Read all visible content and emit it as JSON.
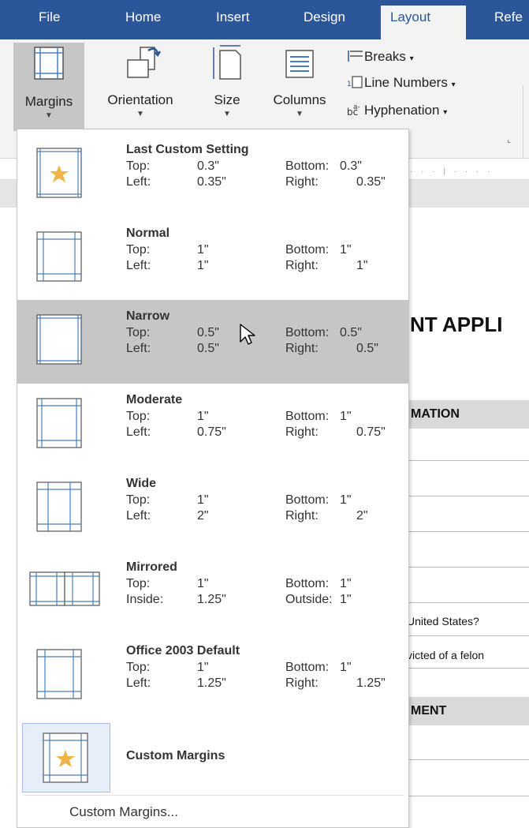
{
  "tabs": [
    {
      "label": "File",
      "active": false
    },
    {
      "label": "Home",
      "active": false
    },
    {
      "label": "Insert",
      "active": false
    },
    {
      "label": "Design",
      "active": false
    },
    {
      "label": "Layout",
      "active": true
    },
    {
      "label": "Refe",
      "active": false
    }
  ],
  "ribbon": {
    "margins": {
      "label": "Margins",
      "icon": "margins-icon"
    },
    "orientation": {
      "label": "Orientation",
      "icon": "orientation-icon"
    },
    "size": {
      "label": "Size",
      "icon": "size-icon"
    },
    "columns": {
      "label": "Columns",
      "icon": "columns-icon"
    },
    "breaks": {
      "label": "Breaks",
      "icon": "breaks-icon"
    },
    "line_numbers": {
      "label": "Line Numbers",
      "icon": "line-numbers-icon"
    },
    "hyphenation": {
      "label": "Hyphenation",
      "icon": "hyphenation-icon"
    }
  },
  "margins_menu": {
    "items": [
      {
        "name": "Last Custom Setting",
        "r1_l": "Top:",
        "r1_v": "0.3\"",
        "r1_rl": "Bottom:",
        "r1_rv": "0.3\"",
        "r2_l": "Left:",
        "r2_v": "0.35\"",
        "r2_rl": "Right:",
        "r2_rv": "0.35\"",
        "highlighted": false,
        "icon": "custom-page-star-icon"
      },
      {
        "name": "Normal",
        "r1_l": "Top:",
        "r1_v": "1\"",
        "r1_rl": "Bottom:",
        "r1_rv": "1\"",
        "r2_l": "Left:",
        "r2_v": "1\"",
        "r2_rl": "Right:",
        "r2_rv": "1\"",
        "highlighted": false,
        "icon": "page-margins-icon"
      },
      {
        "name": "Narrow",
        "r1_l": "Top:",
        "r1_v": "0.5\"",
        "r1_rl": "Bottom:",
        "r1_rv": "0.5\"",
        "r2_l": "Left:",
        "r2_v": "0.5\"",
        "r2_rl": "Right:",
        "r2_rv": "0.5\"",
        "highlighted": true,
        "icon": "page-margins-icon"
      },
      {
        "name": "Moderate",
        "r1_l": "Top:",
        "r1_v": "1\"",
        "r1_rl": "Bottom:",
        "r1_rv": "1\"",
        "r2_l": "Left:",
        "r2_v": "0.75\"",
        "r2_rl": "Right:",
        "r2_rv": "0.75\"",
        "highlighted": false,
        "icon": "page-margins-icon"
      },
      {
        "name": "Wide",
        "r1_l": "Top:",
        "r1_v": "1\"",
        "r1_rl": "Bottom:",
        "r1_rv": "1\"",
        "r2_l": "Left:",
        "r2_v": "2\"",
        "r2_rl": "Right:",
        "r2_rv": "2\"",
        "highlighted": false,
        "icon": "page-margins-icon"
      },
      {
        "name": "Mirrored",
        "r1_l": "Top:",
        "r1_v": "1\"",
        "r1_rl": "Bottom:",
        "r1_rv": "1\"",
        "r2_l": "Inside:",
        "r2_v": "1.25\"",
        "r2_rl": "Outside:",
        "r2_rv": "1\"",
        "highlighted": false,
        "icon": "mirrored-pages-icon"
      },
      {
        "name": "Office 2003 Default",
        "r1_l": "Top:",
        "r1_v": "1\"",
        "r1_rl": "Bottom:",
        "r1_rv": "1\"",
        "r2_l": "Left:",
        "r2_v": "1.25\"",
        "r2_rl": "Right:",
        "r2_rv": "1.25\"",
        "highlighted": false,
        "icon": "page-margins-icon"
      }
    ],
    "custom": {
      "label": "Custom Margins",
      "icon": "custom-page-star-icon"
    },
    "footer": {
      "label": "Custom Margins..."
    }
  },
  "document": {
    "title": "NT APPLI",
    "section1": "MATION",
    "q1": "United States?",
    "q2": "victed of a felon",
    "section2": "MENT"
  },
  "colors": {
    "accent": "#2b579a",
    "highlight": "#c6c6c6",
    "star": "#f0b54a",
    "margin_line": "#4a7ebb"
  }
}
